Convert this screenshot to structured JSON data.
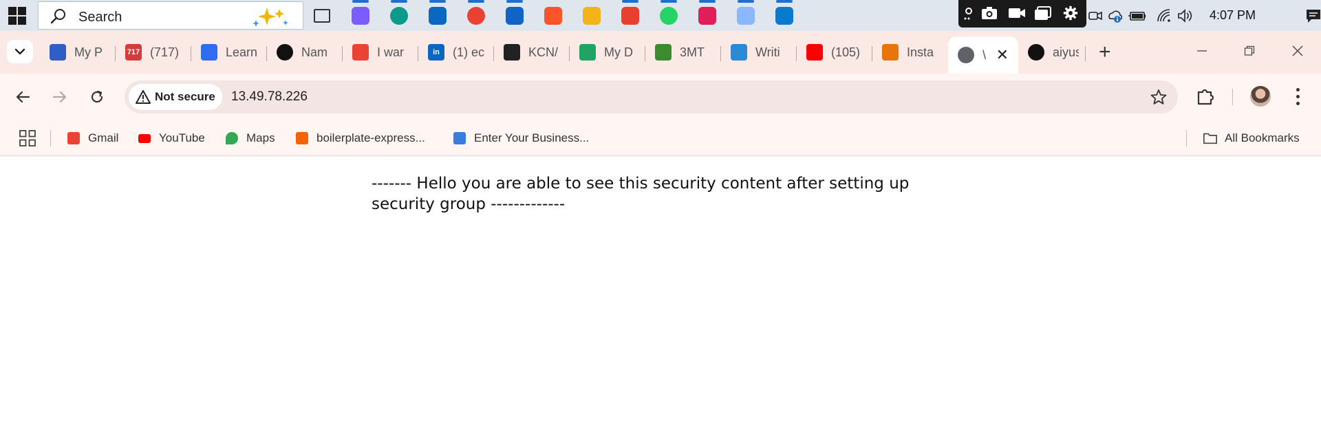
{
  "taskbar": {
    "search_label": "Search",
    "clock": "4:07 PM",
    "apps": [
      {
        "name": "task-view-icon"
      },
      {
        "name": "copilot-icon",
        "color": "#7b5cff"
      },
      {
        "name": "edge-icon",
        "color": "#0c9a8a"
      },
      {
        "name": "store-icon",
        "color": "#0a67c2"
      },
      {
        "name": "chrome-icon",
        "color": "#e94235"
      },
      {
        "name": "outlook-icon",
        "color": "#0f64c5"
      },
      {
        "name": "brave-icon",
        "color": "#fb542b"
      },
      {
        "name": "file-explorer-icon",
        "color": "#f3b417"
      },
      {
        "name": "wps-icon",
        "color": "#e8402f"
      },
      {
        "name": "whatsapp-icon",
        "color": "#25d366"
      },
      {
        "name": "slack-icon",
        "color": "#e01e5a"
      },
      {
        "name": "gitkraken-icon",
        "color": "#8bb7ff"
      },
      {
        "name": "vscode-icon",
        "color": "#0a7acc"
      }
    ]
  },
  "tabs": [
    {
      "title": "My P",
      "favicon": "my-p-icon",
      "color": "#2d5fc4"
    },
    {
      "title": "(717)",
      "favicon": "notification-717-icon",
      "color": "#d63b3b",
      "badge": "717"
    },
    {
      "title": "Learn",
      "favicon": "learn-icon",
      "color": "#2f6df0"
    },
    {
      "title": "Nam",
      "favicon": "chatgpt-icon",
      "color": "#111111"
    },
    {
      "title": "I war",
      "favicon": "gmail-icon",
      "color": "#ea4335"
    },
    {
      "title": "(1) ec",
      "favicon": "linkedin-icon",
      "color": "#0a66c2",
      "badge": "in"
    },
    {
      "title": "KCN/",
      "favicon": "kcn-icon",
      "color": "#222222"
    },
    {
      "title": "My D",
      "favicon": "google-drive-icon",
      "color": "#1fa463"
    },
    {
      "title": "3MT",
      "favicon": "3mt-icon",
      "color": "#3c8c2f"
    },
    {
      "title": "Writi",
      "favicon": "writing-icon",
      "color": "#2a8ad6"
    },
    {
      "title": "(105)",
      "favicon": "youtube-icon",
      "color": "#ff0000"
    },
    {
      "title": "Insta",
      "favicon": "aws-instances-icon",
      "color": "#e8740c"
    },
    {
      "title": "\\",
      "favicon": "globe-icon",
      "color": "#5f6368",
      "active": true
    },
    {
      "title": "aiyus",
      "favicon": "github-icon",
      "color": "#111111"
    }
  ],
  "toolbar": {
    "security_label": "Not secure",
    "url": "13.49.78.226"
  },
  "bookmarks": [
    {
      "label": "Gmail",
      "icon": "gmail-icon",
      "color": "#ea4335"
    },
    {
      "label": "YouTube",
      "icon": "youtube-icon",
      "color": "#ff0000"
    },
    {
      "label": "Maps",
      "icon": "maps-icon",
      "color": "#34a853"
    },
    {
      "label": "boilerplate-express...",
      "icon": "replit-icon",
      "color": "#f26207"
    },
    {
      "label": "Enter Your Business...",
      "icon": "business-icon",
      "color": "#3b7ddd"
    }
  ],
  "all_bookmarks_label": "All Bookmarks",
  "content": {
    "message": "------- Hello you are able to see this security content after setting up security group -------------"
  }
}
